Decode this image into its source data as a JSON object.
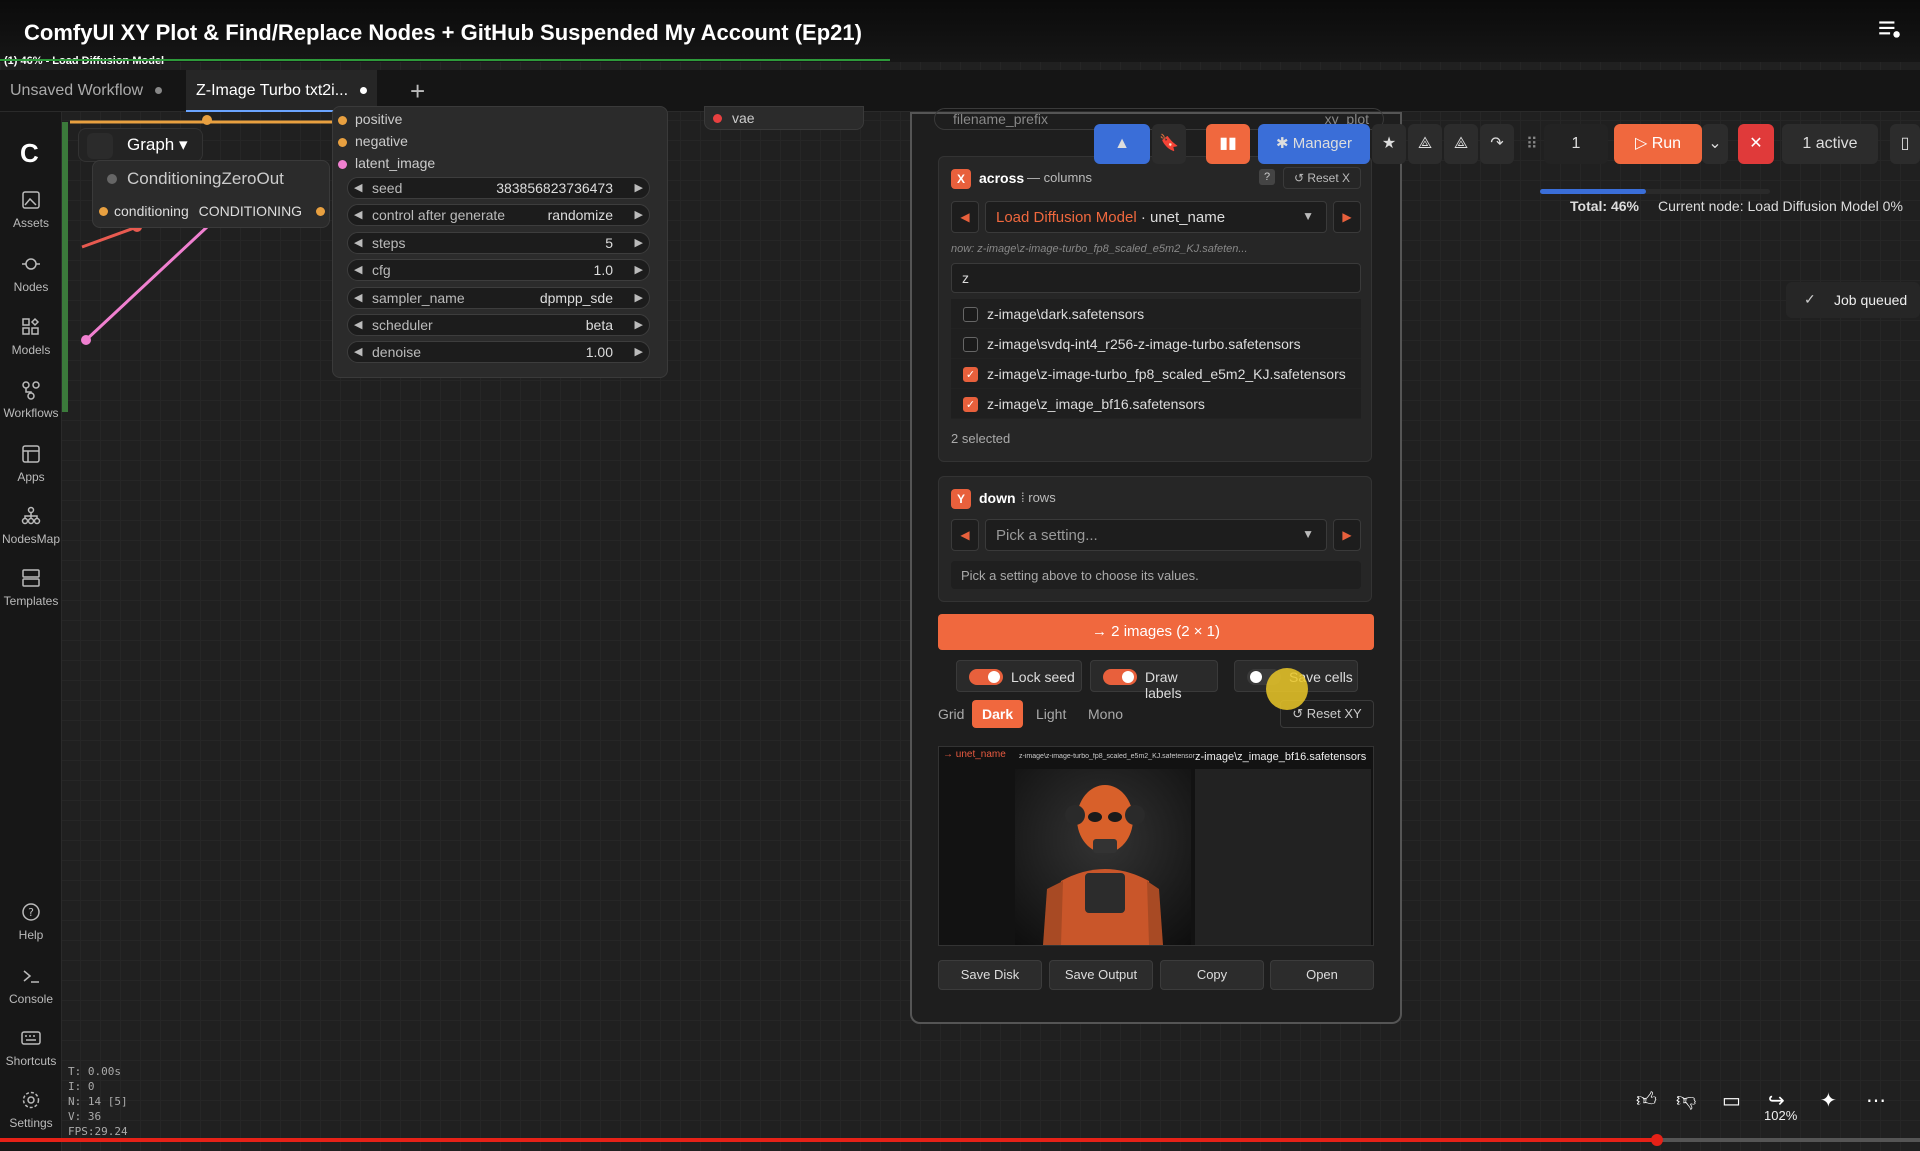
{
  "video": {
    "title": "ComfyUI XY Plot & Find/Replace Nodes + GitHub Suspended My Account (Ep21)"
  },
  "status_small": "(1) 46% - Load Diffusion Model",
  "tabs": [
    {
      "label": "Unsaved Workflow"
    },
    {
      "label": "Z-Image Turbo txt2i..."
    }
  ],
  "sidebar": {
    "items": [
      {
        "label": "Assets",
        "icon": "assets-icon"
      },
      {
        "label": "Nodes",
        "icon": "nodes-icon"
      },
      {
        "label": "Models",
        "icon": "models-icon"
      },
      {
        "label": "Workflows",
        "icon": "workflows-icon"
      },
      {
        "label": "Apps",
        "icon": "apps-icon"
      },
      {
        "label": "NodesMap",
        "icon": "nodesmap-icon"
      },
      {
        "label": "Templates",
        "icon": "templates-icon"
      },
      {
        "label": "Help",
        "icon": "help-icon"
      },
      {
        "label": "Console",
        "icon": "console-icon"
      },
      {
        "label": "Shortcuts",
        "icon": "keyboard-icon"
      },
      {
        "label": "Settings",
        "icon": "gear-icon"
      }
    ]
  },
  "graph": {
    "label": "Graph"
  },
  "nodes": {
    "conditioning_zero_out": {
      "title": "ConditioningZeroOut",
      "output_label": "conditioning",
      "output_type": "CONDITIONING"
    },
    "ksampler": {
      "inputs": [
        "positive",
        "negative",
        "latent_image"
      ],
      "widgets": [
        {
          "label": "seed",
          "value": "383856823736473"
        },
        {
          "label": "control after generate",
          "value": "randomize"
        },
        {
          "label": "steps",
          "value": "5"
        },
        {
          "label": "cfg",
          "value": "1.0"
        },
        {
          "label": "sampler_name",
          "value": "dpmpp_sde"
        },
        {
          "label": "scheduler",
          "value": "beta"
        },
        {
          "label": "denoise",
          "value": "1.00"
        }
      ]
    },
    "vae_label": "vae"
  },
  "xy_panel": {
    "filename_prefix_label": "filename_prefix",
    "filename_prefix_value": "xy_plot",
    "x": {
      "badge": "X",
      "name": "across",
      "dash": "—",
      "sub": "columns",
      "help": "?",
      "reset": "Reset X",
      "setting_node": "Load Diffusion Model",
      "setting_sep": " · ",
      "setting_field": "unet_name",
      "now_text": "now: z-image\\z-image-turbo_fp8_scaled_e5m2_KJ.safeten...",
      "filter": "z",
      "files": [
        {
          "name": "z-image\\dark.safetensors",
          "checked": false
        },
        {
          "name": "z-image\\svdq-int4_r256-z-image-turbo.safetensors",
          "checked": false
        },
        {
          "name": "z-image\\z-image-turbo_fp8_scaled_e5m2_KJ.safetensors",
          "checked": true
        },
        {
          "name": "z-image\\z_image_bf16.safetensors",
          "checked": true
        }
      ],
      "selected_count": "2 selected"
    },
    "y": {
      "badge": "Y",
      "name": "down",
      "dash": "⁞",
      "sub": "rows",
      "placeholder": "Pick a setting...",
      "hint": "Pick a setting above to choose its values."
    },
    "generate_label": "→ 2 images (2 × 1)",
    "toggles": [
      {
        "label": "Lock seed",
        "on": true
      },
      {
        "label": "Draw labels",
        "on": true
      },
      {
        "label": "Save cells",
        "on": false
      }
    ],
    "grid_label": "Grid",
    "themes": [
      "Dark",
      "Light",
      "Mono"
    ],
    "active_theme": "Dark",
    "reset_xy": "Reset XY",
    "preview": {
      "axis_label": "→ unet_name",
      "col1": "z-image\\z-image-turbo_fp8_scaled_e5m2_KJ.safetensors",
      "col2": "z-image\\z_image_bf16.safetensors"
    },
    "buttons": [
      "Save Disk",
      "Save Output",
      "Copy",
      "Open"
    ]
  },
  "toolbar": {
    "manager": "Manager",
    "queue_count": "1",
    "run": "Run",
    "active": "1 active"
  },
  "progress": {
    "total_label": "Total: 46%",
    "current_node": "Current node: Load Diffusion Model 0%",
    "fraction": 0.46
  },
  "toast": {
    "text": "Job queued"
  },
  "stats": {
    "t": "T: 0.00s",
    "i": "I: 0",
    "n": "N: 14 [5]",
    "v": "V: 36",
    "fps": "FPS:29.24"
  },
  "zoom": "102%",
  "colors": {
    "accent": "#f0683e",
    "blue": "#3a6ed8",
    "bg": "#202020"
  }
}
